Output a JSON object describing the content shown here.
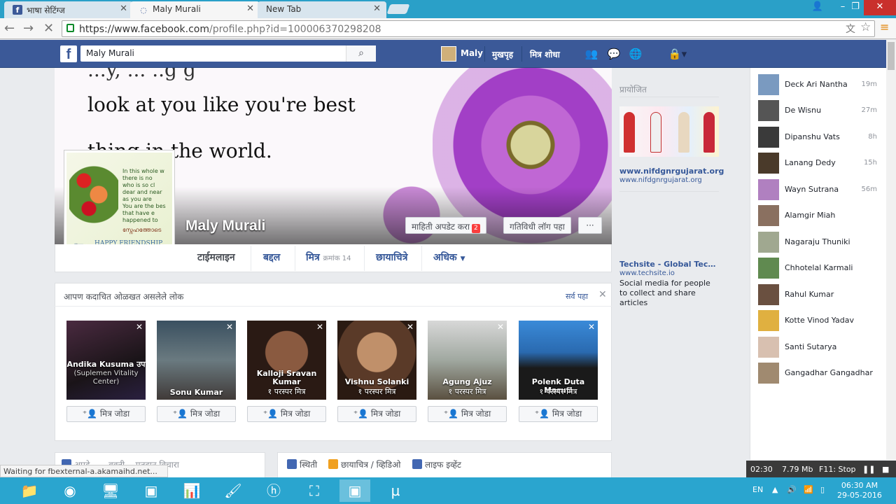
{
  "browser": {
    "tabs": [
      {
        "title": "भाषा सेटिंग्ज"
      },
      {
        "title": "Maly Murali"
      },
      {
        "title": "New Tab"
      }
    ],
    "url_main": "https://www.facebook.com",
    "url_rest": "/profile.php?id=100006370298208",
    "status": "Waiting for fbexternal-a.akamaihd.net..."
  },
  "fb_header": {
    "logo": "f",
    "search_value": "Maly Murali",
    "user": "Maly",
    "home": "मुखपृह",
    "find_friends": "मित्र शोधा",
    "icons": [
      "friend-requests-icon",
      "messages-icon",
      "globe-icon",
      "privacy-lock-icon"
    ]
  },
  "cover": {
    "quote_line1": "look at you like you're best",
    "quote_line2": "thing in the world.",
    "name": "Maly Murali",
    "update_info": "माहिती अपडेट करा",
    "update_badge": "2",
    "activity_log": "गतिविधी लॉग पहा",
    "more": "···"
  },
  "profile_pic": {
    "lines": [
      "In this whole w",
      "there is no",
      "who is so cl",
      "dear and near",
      "as you are",
      "You are the bes",
      "that have e",
      "happened to"
    ],
    "script": "സ്നേഹത്തോടെ",
    "footer": "HAPPY FRIENDSHIP"
  },
  "profile_tabs": {
    "timeline": "टाईमलाइन",
    "about": "बद्दल",
    "friends": "मित्र",
    "friends_count": "क्रमांक 14",
    "photos": "छायाचित्रे",
    "more": "अधिक"
  },
  "pymk": {
    "heading": "आपण कदाचित ओळखत असलेले लोक",
    "see_all": "सर्व पहा",
    "add_friend": "मित्र जोडा",
    "people": [
      {
        "name": "Andika Kusuma उप",
        "sub": "(Suplemen Vitality Center)",
        "mutual": ""
      },
      {
        "name": "Sonu Kumar",
        "sub": "",
        "mutual": ""
      },
      {
        "name": "Kalloji Sravan Kumar",
        "sub": "",
        "mutual": "१ परस्पर मित्र"
      },
      {
        "name": "Vishnu Solanki",
        "sub": "",
        "mutual": "१ परस्पर मित्र"
      },
      {
        "name": "Agung Ajuz",
        "sub": "",
        "mutual": "१ परस्पर मित्र"
      },
      {
        "name": "Polenk Duta Maruti",
        "sub": "",
        "mutual": "१ परस्पर मित्र"
      }
    ]
  },
  "ads": {
    "heading": "प्रायोजित",
    "ad1_title": "www.nifdgnrgujarat.org",
    "ad1_url": "www.nifdgnrgujarat.org",
    "ad2_title": "Techsite - Global Technolo...",
    "ad2_url": "www.techsite.io",
    "ad2_desc": "Social media for people to collect and share articles"
  },
  "composer": {
    "left": "अपडे... ...वक्ती... मतदान विचारा",
    "status": "स्थिती",
    "photo_video": "छायाचित्र / व्हिडिओ",
    "life_event": "लाइफ इव्हेंट"
  },
  "chat": [
    {
      "name": "Deck Ari Nantha",
      "time": "19m"
    },
    {
      "name": "De Wisnu",
      "time": "27m"
    },
    {
      "name": "Dipanshu Vats",
      "time": "8h"
    },
    {
      "name": "Lanang Dedy",
      "time": "15h"
    },
    {
      "name": "Wayn Sutrana",
      "time": "56m"
    },
    {
      "name": "Alamgir Miah",
      "time": ""
    },
    {
      "name": "Nagaraju Thuniki",
      "time": ""
    },
    {
      "name": "Chhotelal Karmali",
      "time": ""
    },
    {
      "name": "Rahul Kumar",
      "time": ""
    },
    {
      "name": "Kotte Vinod Yadav",
      "time": ""
    },
    {
      "name": "Santi Sutarya",
      "time": ""
    },
    {
      "name": "Gangadhar Gangadhar",
      "time": ""
    }
  ],
  "recorder": {
    "time": "02:30",
    "size": "7.79 Mb",
    "stop": "F11: Stop"
  },
  "taskbar": {
    "lang": "EN",
    "time": "06:30 AM",
    "date": "29-05-2016"
  }
}
